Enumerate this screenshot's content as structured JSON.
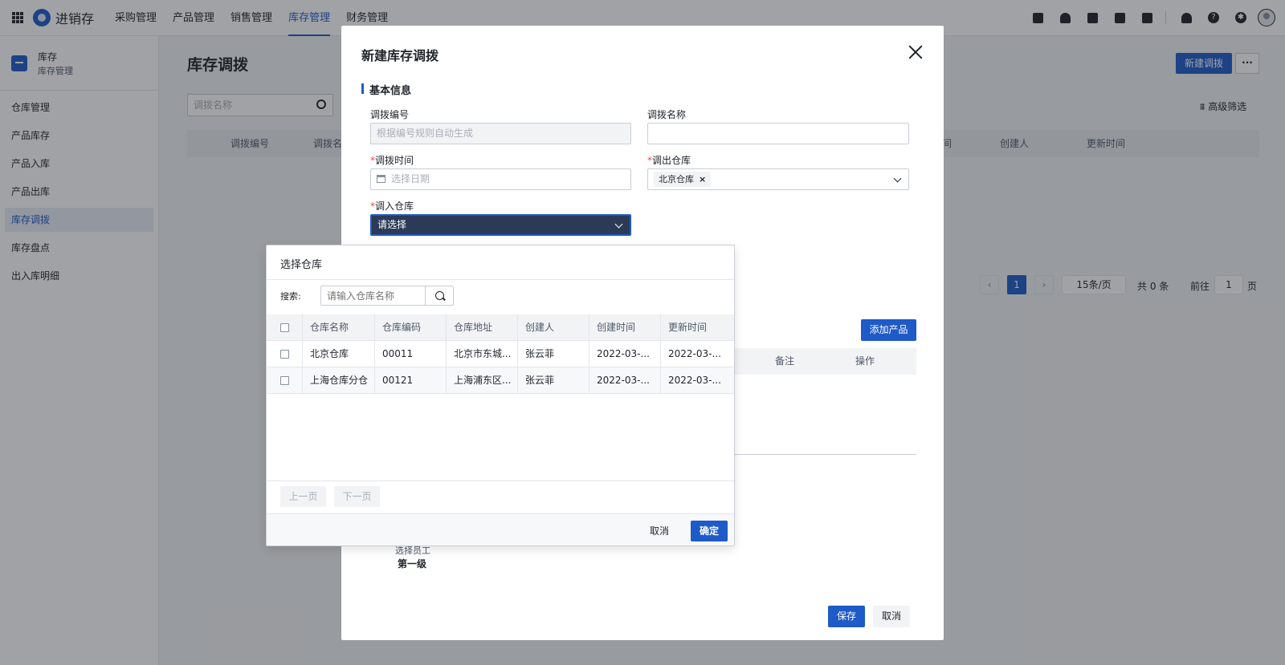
{
  "app": {
    "name": "进销存"
  },
  "nav": [
    "采购管理",
    "产品管理",
    "销售管理",
    "库存管理",
    "财务管理"
  ],
  "nav_active": "库存管理",
  "top_tools": [
    "calendar-check-icon",
    "user-icon",
    "document-icon",
    "phone-icon",
    "calendar-icon",
    "bell-icon",
    "help-icon",
    "gear-icon"
  ],
  "sidebar": {
    "title": "库存",
    "subtitle": "库存管理",
    "items": [
      "仓库管理",
      "产品库存",
      "产品入库",
      "产品出库",
      "库存调拨",
      "库存盘点",
      "出入库明细"
    ],
    "active": "库存调拨"
  },
  "page": {
    "title": "库存调拨",
    "search_placeholder": "调拨名称",
    "new_button": "新建调拨",
    "more_button": "···",
    "filter": "高级筛选",
    "columns": [
      "调拨编号",
      "调拨名",
      "间",
      "创建人",
      "更新时间"
    ],
    "pagination": {
      "current": "1",
      "page_size": "15条/页",
      "total": "共 0 条",
      "goto_prefix": "前往",
      "goto_value": "1",
      "goto_suffix": "页"
    }
  },
  "modal": {
    "title": "新建库存调拨",
    "section": "基本信息",
    "fields": {
      "transfer_no": {
        "label": "调拨编号",
        "placeholder": "根据编号规则自动生成"
      },
      "transfer_name": {
        "label": "调拨名称",
        "value": ""
      },
      "transfer_time": {
        "label": "调拨时间",
        "placeholder": "选择日期"
      },
      "out_warehouse": {
        "label": "调出仓库",
        "tag": "北京仓库",
        "tag_close": "×"
      },
      "in_warehouse": {
        "label": "调入仓库",
        "value": "请选择"
      }
    },
    "required_mark": "*",
    "add_product": "添加产品",
    "product_columns": [
      "备注",
      "操作"
    ],
    "approver_label": "选择员工",
    "approver_level": "第一级",
    "save": "保存",
    "cancel": "取消"
  },
  "picker": {
    "title": "选择仓库",
    "search_label": "搜索:",
    "search_placeholder": "请输入仓库名称",
    "columns": [
      "仓库名称",
      "仓库编码",
      "仓库地址",
      "创建人",
      "创建时间",
      "更新时间"
    ],
    "rows": [
      [
        "北京仓库",
        "00011",
        "北京市东城...",
        "张云菲",
        "2022-03-...",
        "2022-03-..."
      ],
      [
        "上海仓库分仓",
        "00121",
        "上海浦东区...",
        "张云菲",
        "2022-03-...",
        "2022-03-..."
      ]
    ],
    "prev": "上一页",
    "next": "下一页",
    "cancel": "取消",
    "confirm": "确定"
  },
  "colors": {
    "primary": "#1e5ac8",
    "required": "#f53f3f",
    "active_select": "#2b3a57"
  }
}
